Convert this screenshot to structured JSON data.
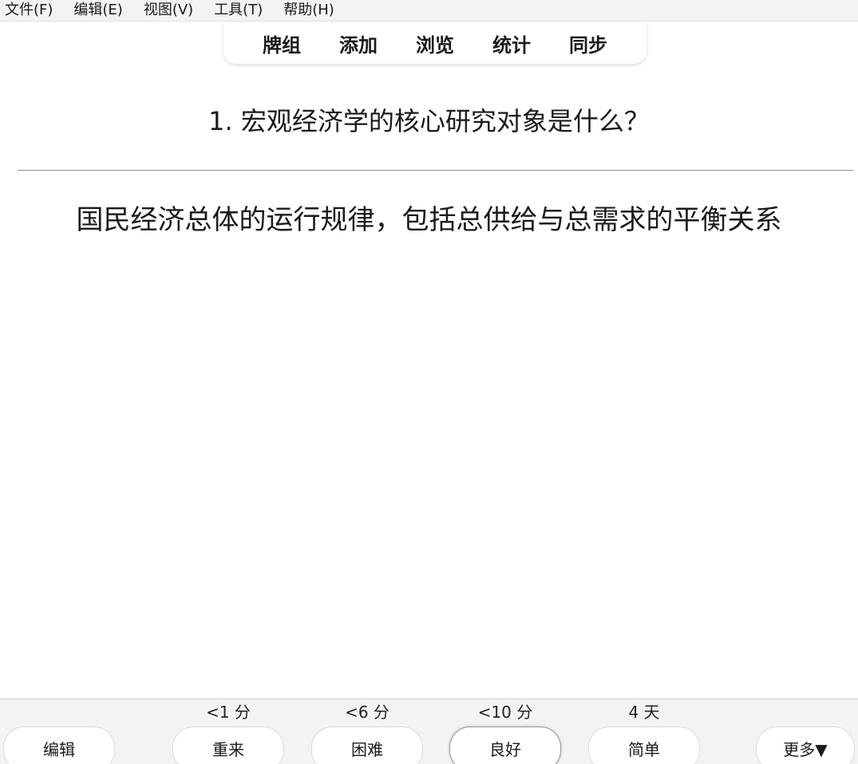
{
  "menubar": {
    "items": [
      "文件(F)",
      "编辑(E)",
      "视图(V)",
      "工具(T)",
      "帮助(H)"
    ]
  },
  "toolbar": {
    "items": [
      "牌组",
      "添加",
      "浏览",
      "统计",
      "同步"
    ]
  },
  "card": {
    "question": "1. 宏观经济学的核心研究对象是什么？",
    "answer": "国民经济总体的运行规律，包括总供给与总需求的平衡关系"
  },
  "bottombar": {
    "edit_label": "编辑",
    "more_label": "更多▼",
    "answers": [
      {
        "interval": "<1 分",
        "label": "重来"
      },
      {
        "interval": "<6 分",
        "label": "困难"
      },
      {
        "interval": "<10 分",
        "label": "良好"
      },
      {
        "interval": "4 天",
        "label": "简单"
      }
    ]
  }
}
